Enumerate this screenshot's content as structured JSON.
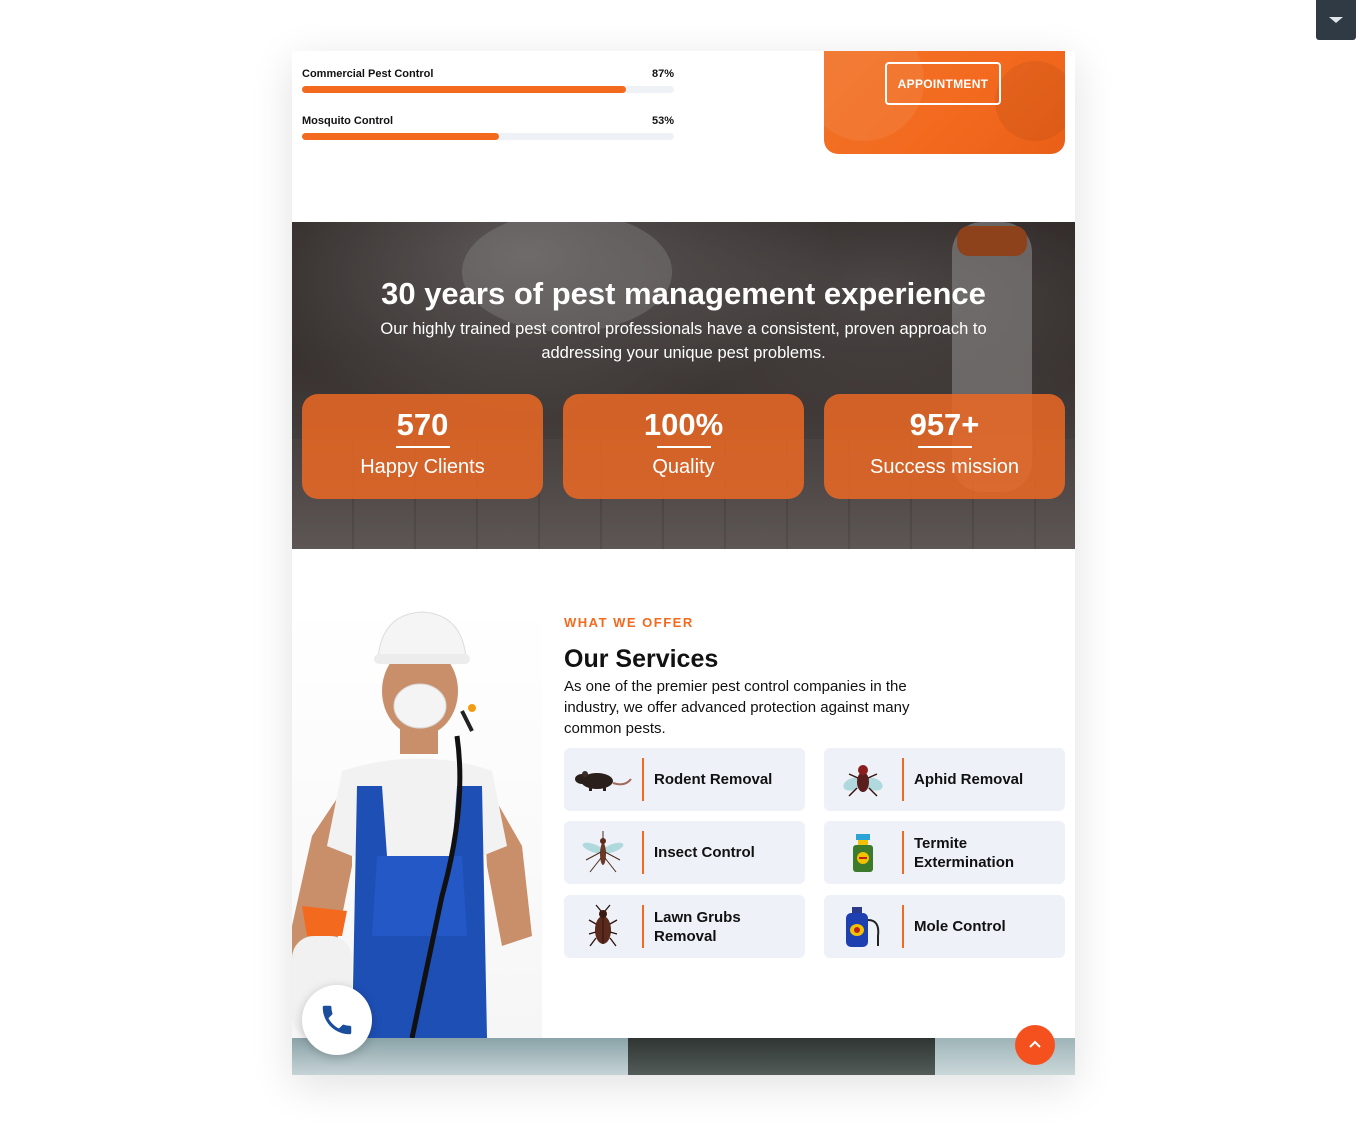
{
  "skills": [
    {
      "label": "Commercial Pest Control",
      "percent_text": "87%",
      "value": 87
    },
    {
      "label": "Mosquito Control",
      "percent_text": "53%",
      "value": 53
    }
  ],
  "appointment": {
    "label": "APPOINTMENT"
  },
  "hero": {
    "title": "30 years of pest management experience",
    "subtitle": "Our highly trained pest control professionals have a consistent, proven approach to addressing your unique pest problems."
  },
  "stats": [
    {
      "number": "570",
      "label": "Happy Clients"
    },
    {
      "number": "100%",
      "label": "Quality"
    },
    {
      "number": "957+",
      "label": "Success mission"
    }
  ],
  "services": {
    "eyebrow": "WHAT WE OFFER",
    "title": "Our Services",
    "description": "As one of the premier pest control companies in the industry, we offer advanced protection against many common pests.",
    "items": [
      {
        "label": "Rodent Removal",
        "icon": "rat-icon"
      },
      {
        "label": "Aphid Removal",
        "icon": "fly-icon"
      },
      {
        "label": "Insect Control",
        "icon": "mosquito-icon"
      },
      {
        "label": "Termite Extermination",
        "icon": "spray-bottle-icon"
      },
      {
        "label": "Lawn Grubs Removal",
        "icon": "cockroach-icon"
      },
      {
        "label": "Mole Control",
        "icon": "sprayer-icon"
      }
    ]
  },
  "colors": {
    "accent": "#f36a1f",
    "dark": "#2f3a45",
    "card": "#eef1f8"
  }
}
